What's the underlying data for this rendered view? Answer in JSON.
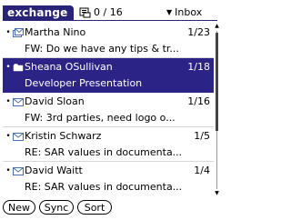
{
  "header": {
    "app_title": "exchange",
    "unread_count": "0 / 16",
    "folder": "Inbox"
  },
  "messages": [
    {
      "sender": "Martha Nino",
      "count": "1/23",
      "subject": "FW: Do we have any tips & tr...",
      "icon": "envelope-stack-icon",
      "selected": false
    },
    {
      "sender": "Sheana OSullivan",
      "count": "1/18",
      "subject": "Developer Presentation",
      "icon": "folder-icon",
      "selected": true
    },
    {
      "sender": "David Sloan",
      "count": "1/16",
      "subject": "FW: 3rd parties, need logo o...",
      "icon": "envelope-icon",
      "selected": false
    },
    {
      "sender": "Kristin Schwarz",
      "count": "1/5",
      "subject": "RE: SAR values in documenta...",
      "icon": "envelope-icon",
      "selected": false
    },
    {
      "sender": "David Waitt",
      "count": "1/4",
      "subject": "RE: SAR values in documenta...",
      "icon": "envelope-icon",
      "selected": false
    }
  ],
  "toolbar": {
    "new_label": "New",
    "sync_label": "Sync",
    "sort_label": "Sort"
  },
  "colors": {
    "accent": "#2c2387",
    "envelope": "#4a6fb3"
  }
}
